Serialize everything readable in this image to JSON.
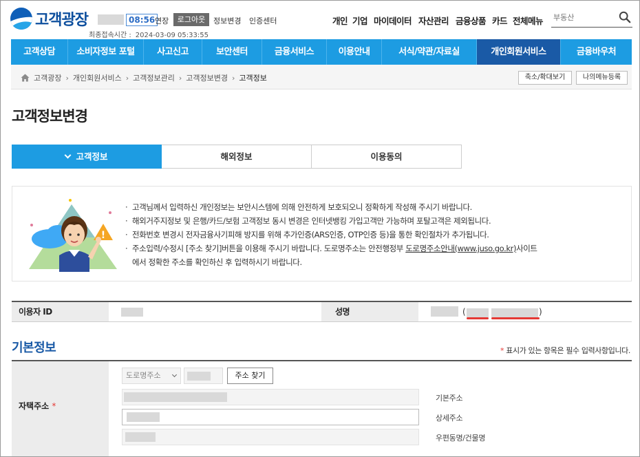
{
  "header": {
    "logo_text": "고객광장",
    "timer": "08:56",
    "extend_label": "연장",
    "logout_label": "로그아웃",
    "info_change_label": "정보변경",
    "cert_center_label": "인증센터",
    "last_login_label": "최종접속시간 :",
    "last_login_value": "2024-03-09 05:33:55",
    "gnb": [
      "개인",
      "기업",
      "마이데이터",
      "자산관리",
      "금융상품",
      "카드",
      "전체메뉴"
    ],
    "search_placeholder": "부동산"
  },
  "main_nav": [
    "고객상담",
    "소비자정보 포털",
    "사고신고",
    "보안센터",
    "금융서비스",
    "이용안내",
    "서식/약관/자료실",
    "개인회원서비스",
    "금융바우처"
  ],
  "main_nav_active": "개인회원서비스",
  "breadcrumb": [
    "고객광장",
    "개인회원서비스",
    "고객정보관리",
    "고객정보변경",
    "고객정보"
  ],
  "breadcrumb_buttons": {
    "zoom": "축소/확대보기",
    "my_menu": "나의메뉴등록"
  },
  "page_title": "고객정보변경",
  "tabs": [
    "고객정보",
    "해외정보",
    "이용동의"
  ],
  "notice": [
    "고객님께서 입력하신 개인정보는 보안시스템에 의해 안전하게 보호되오니 정확하게 작성해 주시기 바랍니다.",
    "해외거주지정보 및 은행/카드/보험 고객정보 동시 변경은 인터넷뱅킹 가입고객만 가능하며 포탈고객은 제외됩니다.",
    "전화번호 변경시 전자금융사기피해 방지를 위해 추가인증(ARS인증, OTP인증 등)을 통한 확인절차가 추가됩니다."
  ],
  "notice_address": {
    "part1": "주소입력/수정시 [주소 찾기]버튼을 이용해 주시기 바랍니다. 도로명주소는 안전행정부 ",
    "link": "도로명주소안내(www.juso.go.kr)",
    "part2": "사이트",
    "line2": "에서 정확한 주소를 확인하신 후 입력하시기 바랍니다."
  },
  "user_info": {
    "id_label": "이용자 ID",
    "name_label": "성명",
    "paren_open": "(",
    "paren_close": ")"
  },
  "basic_info": {
    "title": "기본정보",
    "required_star": "*",
    "required_note": "표시가 있는 항목은 필수 입력사항입니다."
  },
  "address": {
    "label": "자택주소",
    "type_selected": "도로명주소",
    "find_button": "주소 찾기",
    "basic_label": "기본주소",
    "detail_label": "상세주소",
    "postal_label": "우편동명/건물명"
  },
  "colors": {
    "primary": "#1d9ce2",
    "active_nav": "#1a5aa6",
    "required": "#e53935"
  }
}
